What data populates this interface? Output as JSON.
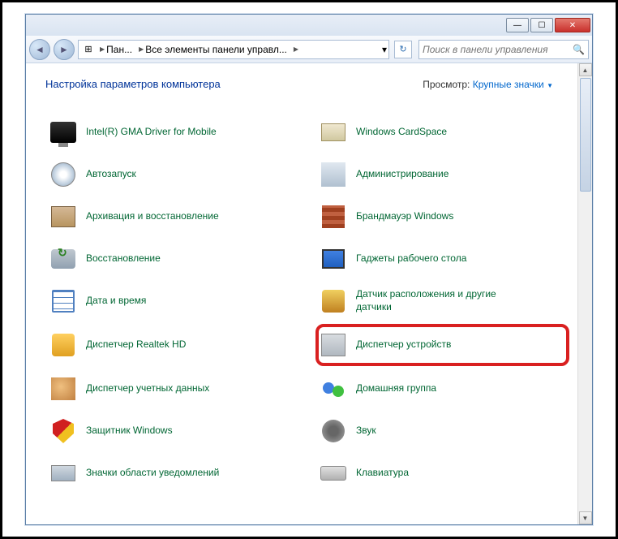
{
  "breadcrumb": {
    "seg1": "Пан...",
    "seg2": "Все элементы панели управл..."
  },
  "search": {
    "placeholder": "Поиск в панели управления"
  },
  "header": {
    "title": "Настройка параметров компьютера",
    "view_label": "Просмотр:",
    "view_value": "Крупные значки"
  },
  "items": {
    "left": [
      {
        "label": "Intel(R) GMA Driver for Mobile",
        "icon": "ic-monitor",
        "name": "intel-gma"
      },
      {
        "label": "Автозапуск",
        "icon": "ic-cd",
        "name": "autoplay"
      },
      {
        "label": "Архивация и восстановление",
        "icon": "ic-box",
        "name": "backup-restore"
      },
      {
        "label": "Восстановление",
        "icon": "ic-disk",
        "name": "recovery"
      },
      {
        "label": "Дата и время",
        "icon": "ic-cal",
        "name": "date-time"
      },
      {
        "label": "Диспетчер Realtek HD",
        "icon": "ic-speaker",
        "name": "realtek-hd"
      },
      {
        "label": "Диспетчер учетных данных",
        "icon": "ic-users",
        "name": "credential-manager"
      },
      {
        "label": "Защитник Windows",
        "icon": "ic-shield",
        "name": "windows-defender"
      },
      {
        "label": "Значки области уведомлений",
        "icon": "ic-tray",
        "name": "notification-icons"
      }
    ],
    "right": [
      {
        "label": "Windows CardSpace",
        "icon": "ic-card",
        "name": "cardspace"
      },
      {
        "label": "Администрирование",
        "icon": "ic-tools",
        "name": "administration"
      },
      {
        "label": "Брандмауэр Windows",
        "icon": "ic-wall",
        "name": "firewall"
      },
      {
        "label": "Гаджеты рабочего стола",
        "icon": "ic-gadget",
        "name": "desktop-gadgets"
      },
      {
        "label": "Датчик расположения и другие датчики",
        "icon": "ic-sensor",
        "name": "location-sensors"
      },
      {
        "label": "Диспетчер устройств",
        "icon": "ic-device",
        "name": "device-manager",
        "highlight": true
      },
      {
        "label": "Домашняя группа",
        "icon": "ic-group",
        "name": "homegroup"
      },
      {
        "label": "Звук",
        "icon": "ic-sound",
        "name": "sound"
      },
      {
        "label": "Клавиатура",
        "icon": "ic-keyb",
        "name": "keyboard"
      }
    ]
  }
}
